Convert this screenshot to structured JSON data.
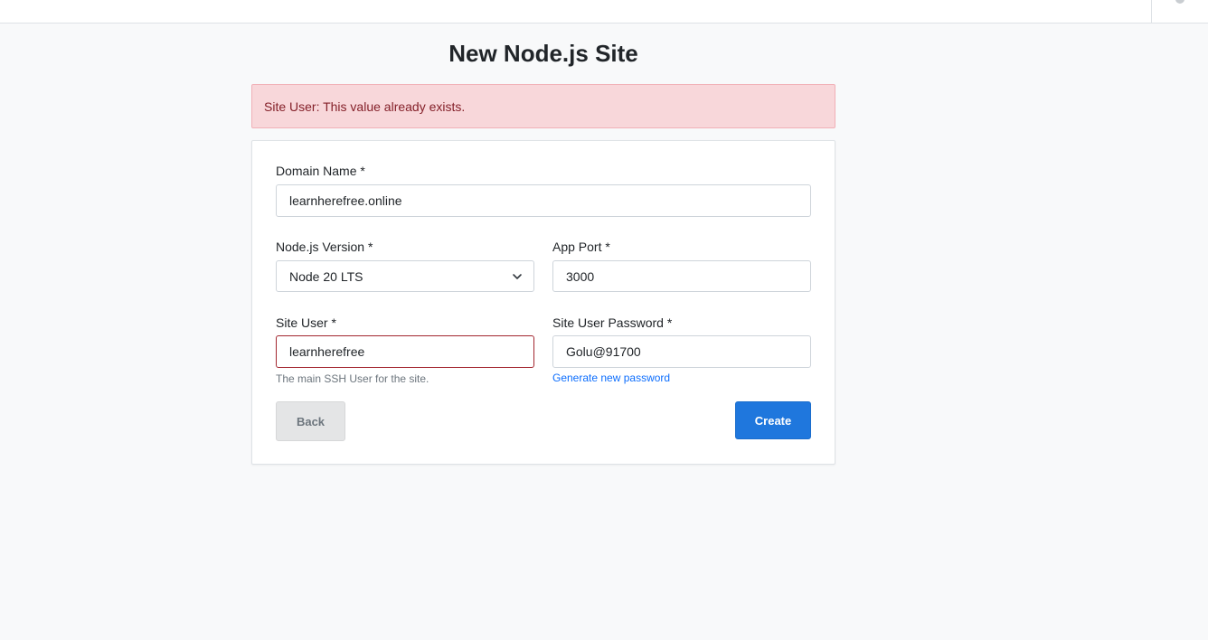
{
  "page": {
    "title": "New Node.js Site"
  },
  "alert": {
    "message": "Site User: This value already exists."
  },
  "form": {
    "domain_name": {
      "label": "Domain Name *",
      "value": "learnherefree.online"
    },
    "nodejs_version": {
      "label": "Node.js Version *",
      "value": "Node 20 LTS"
    },
    "app_port": {
      "label": "App Port *",
      "value": "3000"
    },
    "site_user": {
      "label": "Site User *",
      "value": "learnherefree",
      "help": "The main SSH User for the site."
    },
    "site_user_password": {
      "label": "Site User Password *",
      "value": "Golu@91700",
      "generate_link": "Generate new password"
    },
    "back_label": "Back",
    "create_label": "Create"
  },
  "colors": {
    "primary": "#1f77dd",
    "alert_bg": "#f8d7da",
    "alert_text": "#842029",
    "invalid_border": "#a3262f"
  },
  "icons": {
    "select": "chevron-down-icon",
    "user": "user-avatar-icon"
  }
}
